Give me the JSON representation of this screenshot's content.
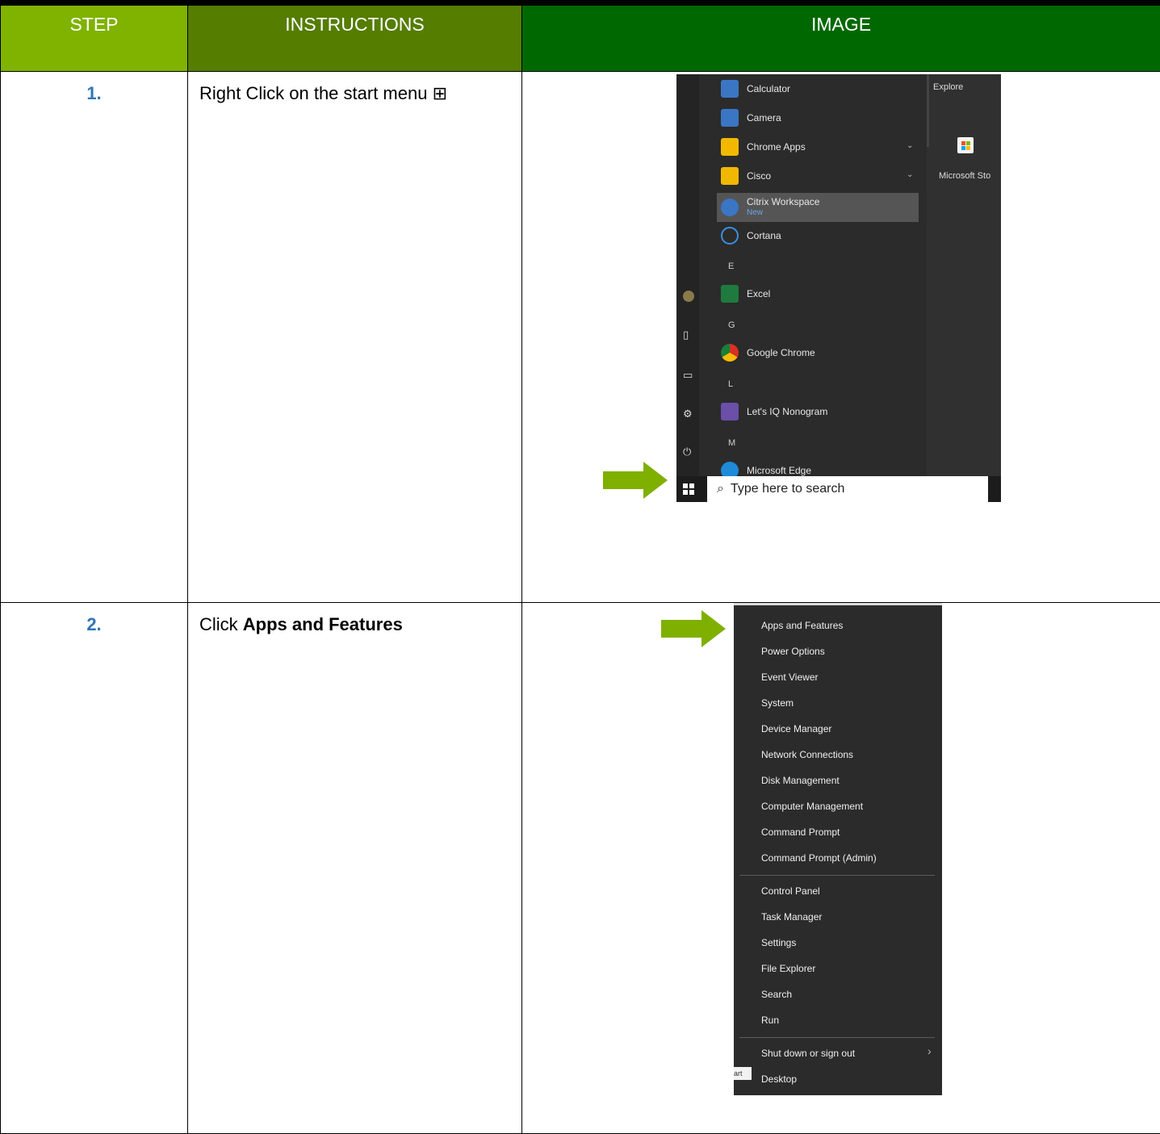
{
  "header": {
    "step": "STEP",
    "instructions": "INSTRUCTIONS",
    "image": "IMAGE"
  },
  "colors": {
    "header_step": "#80b200",
    "header_instructions": "#557d00",
    "header_image": "#006800",
    "step_number": "#2e75b6",
    "arrow": "#7fb000"
  },
  "rows": [
    {
      "step": "1.",
      "instruction_text": "Right Click on the start menu ",
      "instruction_icon": "⊞",
      "start_menu": {
        "explore_label": "Explore",
        "store_label": "Microsoft Sto",
        "items": [
          {
            "label": "Calculator",
            "icon": "calculator-icon",
            "color": "#3a76c4"
          },
          {
            "label": "Camera",
            "icon": "camera-icon",
            "color": "#3a76c4"
          },
          {
            "label": "Chrome Apps",
            "icon": "folder-icon",
            "color": "#f2b800"
          },
          {
            "label": "Cisco",
            "icon": "folder-icon",
            "color": "#f2b800"
          },
          {
            "label": "Citrix Workspace",
            "sub": "New",
            "icon": "citrix-icon",
            "color": "#3a76c4"
          },
          {
            "label": "Cortana",
            "icon": "cortana-icon",
            "color": "#3a76c4"
          },
          {
            "label": "Excel",
            "icon": "excel-icon",
            "color": "#1f7a3f"
          },
          {
            "label": "Google Chrome",
            "icon": "chrome-icon",
            "color": "#d93025"
          },
          {
            "label": "Let's IQ Nonogram",
            "icon": "nonogram-icon",
            "color": "#6b4fa8"
          },
          {
            "label": "Microsoft Edge",
            "icon": "edge-icon",
            "color": "#1e8ad8"
          }
        ],
        "letters": [
          "E",
          "G",
          "L",
          "M"
        ],
        "search_placeholder": "Type here to search"
      }
    },
    {
      "step": "2.",
      "instruction_prefix": "Click ",
      "instruction_bold": "Apps and Features",
      "context_menu": {
        "group1": [
          "Apps and Features",
          "Power Options",
          "Event Viewer",
          "System",
          "Device Manager",
          "Network Connections",
          "Disk Management",
          "Computer Management",
          "Command Prompt",
          "Command Prompt (Admin)"
        ],
        "group2": [
          "Control Panel",
          "Task Manager",
          "Settings",
          "File Explorer",
          "Search",
          "Run"
        ],
        "group3": [
          "Shut down or sign out",
          "Desktop"
        ],
        "tooltip": "art"
      }
    }
  ]
}
